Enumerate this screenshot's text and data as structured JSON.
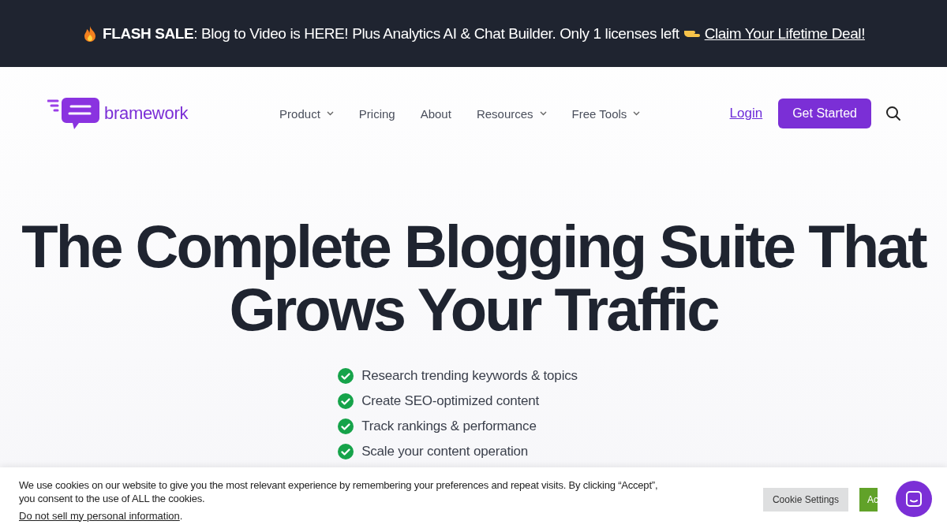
{
  "banner": {
    "lead": "FLASH SALE",
    "text": ": Blog to Video is HERE! Plus Analytics AI & Chat Builder. Only 1 licenses left",
    "link": "Claim Your Lifetime Deal!"
  },
  "logo": {
    "text": "bramework"
  },
  "nav": {
    "items": [
      {
        "label": "Product",
        "dropdown": true
      },
      {
        "label": "Pricing",
        "dropdown": false
      },
      {
        "label": "About",
        "dropdown": false
      },
      {
        "label": "Resources",
        "dropdown": true
      },
      {
        "label": "Free Tools",
        "dropdown": true
      }
    ],
    "login": "Login",
    "cta": "Get Started"
  },
  "hero": {
    "title_lines": [
      "The Complete Blogging Suite That",
      "Grows Your Traffic"
    ],
    "features": [
      "Research trending keywords & topics",
      "Create SEO-optimized content",
      "Track rankings & performance",
      "Scale your content operation"
    ]
  },
  "cookie_bar": {
    "text": "We use cookies on our website to give you the most relevant experience by remembering your preferences and repeat visits. By clicking “Accept”, you consent to the use of ALL the cookies.",
    "link": "Do not sell my personal information",
    "link_end": ".",
    "settings": "Cookie Settings",
    "accept": "Ac"
  }
}
